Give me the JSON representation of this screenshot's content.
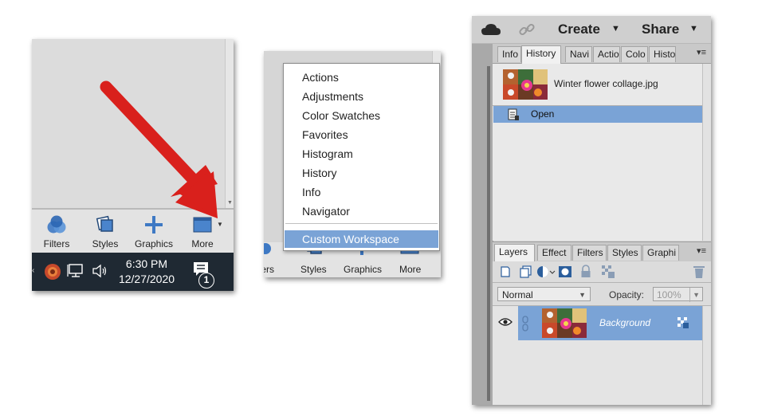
{
  "panel1": {
    "toolbar": [
      {
        "label": "Filters",
        "icon": "filters-icon"
      },
      {
        "label": "Styles",
        "icon": "styles-icon"
      },
      {
        "label": "Graphics",
        "icon": "graphics-icon"
      },
      {
        "label": "More",
        "icon": "more-panels-icon"
      }
    ],
    "taskbar": {
      "time": "6:30 PM",
      "date": "12/27/2020",
      "notification_count": "1"
    },
    "arrow_color": "#d9201c"
  },
  "panel2": {
    "menu": [
      "Actions",
      "Adjustments",
      "Color Swatches",
      "Favorites",
      "Histogram",
      "History",
      "Info",
      "Navigator"
    ],
    "menu_selected": "Custom Workspace",
    "toolbar": [
      {
        "label": "ters"
      },
      {
        "label": "Styles"
      },
      {
        "label": "Graphics"
      },
      {
        "label": "More"
      }
    ]
  },
  "panel3": {
    "top": {
      "create": "Create",
      "share": "Share"
    },
    "tabs": [
      "Info",
      "History",
      "Navi",
      "Actio",
      "Colo",
      "Histo"
    ],
    "history": {
      "file": "Winter flower collage.jpg",
      "step": "Open"
    },
    "layer_tabs": [
      "Layers",
      "Effect",
      "Filters",
      "Styles",
      "Graphi"
    ],
    "blend_mode": "Normal",
    "opacity_label": "Opacity:",
    "opacity_value": "100%",
    "layer_name": "Background",
    "highlight_color": "#7aa3d6"
  }
}
